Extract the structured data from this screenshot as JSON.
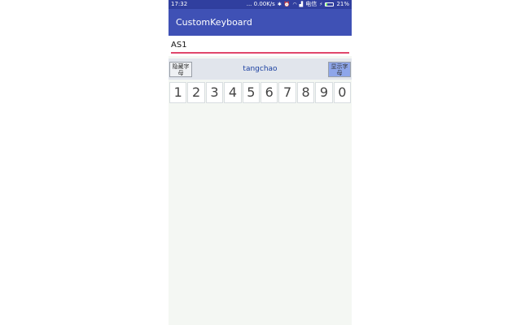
{
  "statusbar": {
    "time": "17:32",
    "network_speed": "... 0.00K/s",
    "carrier": "电信",
    "battery_percent": "21%",
    "battery_level": 0.21
  },
  "appbar": {
    "title": "CustomKeyboard"
  },
  "edit": {
    "value": "AS1"
  },
  "keyboard": {
    "hide_label": "隐藏字母",
    "title": "tangchao",
    "show_label": "显示字母",
    "digits": [
      "1",
      "2",
      "3",
      "4",
      "5",
      "6",
      "7",
      "8",
      "9",
      "0"
    ]
  }
}
